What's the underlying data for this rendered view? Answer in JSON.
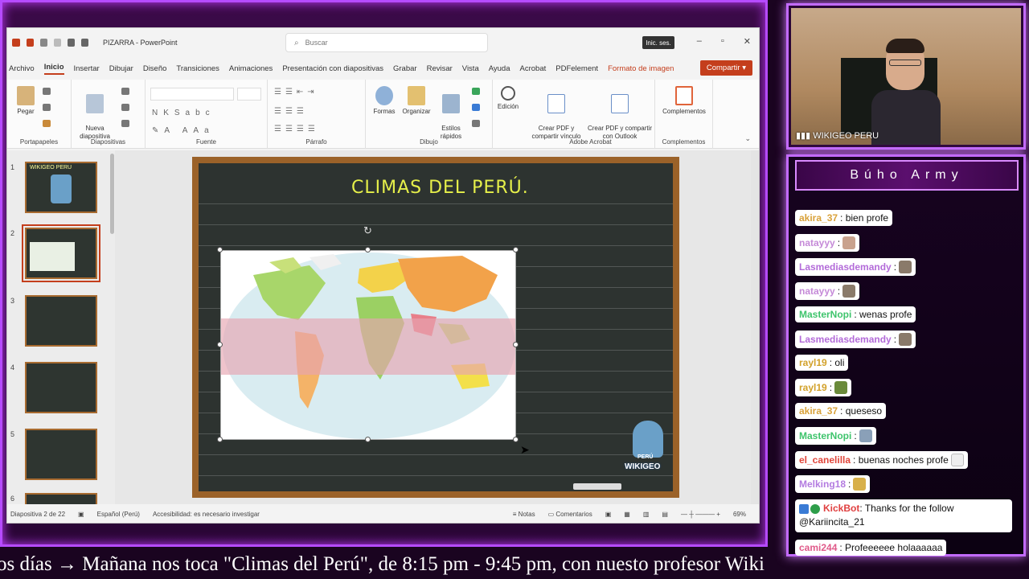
{
  "ppt": {
    "app_title": "PIZARRA - PowerPoint",
    "search_placeholder": "Buscar",
    "signin_label": "Inic. ses.",
    "menu": [
      "Archivo",
      "Inicio",
      "Insertar",
      "Dibujar",
      "Diseño",
      "Transiciones",
      "Animaciones",
      "Presentación con diapositivas",
      "Grabar",
      "Revisar",
      "Vista",
      "Ayuda",
      "Acrobat",
      "PDFelement",
      "Formato de imagen"
    ],
    "share_label": "Compartir",
    "ribbon": {
      "pegar": "Pegar",
      "nueva": "Nueva\ndiapositiva",
      "formas": "Formas",
      "organizar": "Organizar",
      "estilos": "Estilos\nrápidos",
      "edicion": "Edición",
      "crear_pdf": "Crear PDF y\ncompartir vínculo",
      "crear_pdf_outlook": "Crear PDF y compartir\ncon Outlook",
      "complementos": "Complementos",
      "groups": [
        "Portapapeles",
        "Diapositivas",
        "Fuente",
        "Párrafo",
        "Dibujo",
        "Adobe Acrobat",
        "Complementos"
      ]
    },
    "thumb_numbers": [
      "1",
      "2",
      "3",
      "4",
      "5",
      "6"
    ],
    "slide_title": "CLIMAS DEL PERÚ.",
    "logo_text": [
      "PERÚ",
      "WIKIGEO"
    ],
    "thumb1_text": "WIKIGEO PERU",
    "status": {
      "slide_count": "Diapositiva 2 de 22",
      "language": "Español (Perú)",
      "accessibility": "Accesibilidad: es necesario investigar",
      "notes": "Notas",
      "comments": "Comentarios",
      "zoom": "69%"
    }
  },
  "cam": {
    "label": "WIKIGEO PERU"
  },
  "chat": {
    "title": "Búho Army",
    "messages": [
      {
        "user": "akira_37",
        "color": "#d9a23b",
        "text": ": bien profe"
      },
      {
        "user": "natayyy",
        "color": "#c58ad8",
        "text": ":",
        "emote": true
      },
      {
        "user": "Lasmediasdemandy",
        "color": "#b36bd9",
        "text": ":",
        "emote": true
      },
      {
        "user": "natayyy",
        "color": "#c58ad8",
        "text": ":",
        "emote": true
      },
      {
        "user": "MasterNopi",
        "color": "#3ec46c",
        "text": ": wenas profe"
      },
      {
        "user": "Lasmediasdemandy",
        "color": "#b36bd9",
        "text": ":",
        "emote": true
      },
      {
        "user": "rayl19",
        "color": "#d2a12a",
        "text": ": oli"
      },
      {
        "user": "rayl19",
        "color": "#d2a12a",
        "text": ":",
        "emote": true
      },
      {
        "user": "akira_37",
        "color": "#d9a23b",
        "text": ": queseso"
      },
      {
        "user": "MasterNopi",
        "color": "#3ec46c",
        "text": ":",
        "emote": true
      },
      {
        "user": "el_canelilla",
        "color": "#e0453a",
        "text": ": buenas noches profe",
        "emote": true
      },
      {
        "user": "Melking18",
        "color": "#b37be0",
        "text": ":",
        "emote": true
      },
      {
        "user": "KickBot",
        "color": "#e04040",
        "text": ": Thanks for the follow @Kariincita_21"
      },
      {
        "user": "cami244",
        "color": "#e05a8a",
        "text": ": Profeeeeee holaaaaaa"
      }
    ]
  },
  "ticker": "os días  →  Mañana nos toca \"Climas del Perú\", de 8:15 pm - 9:45 pm, con nuesto profesor Wiki"
}
